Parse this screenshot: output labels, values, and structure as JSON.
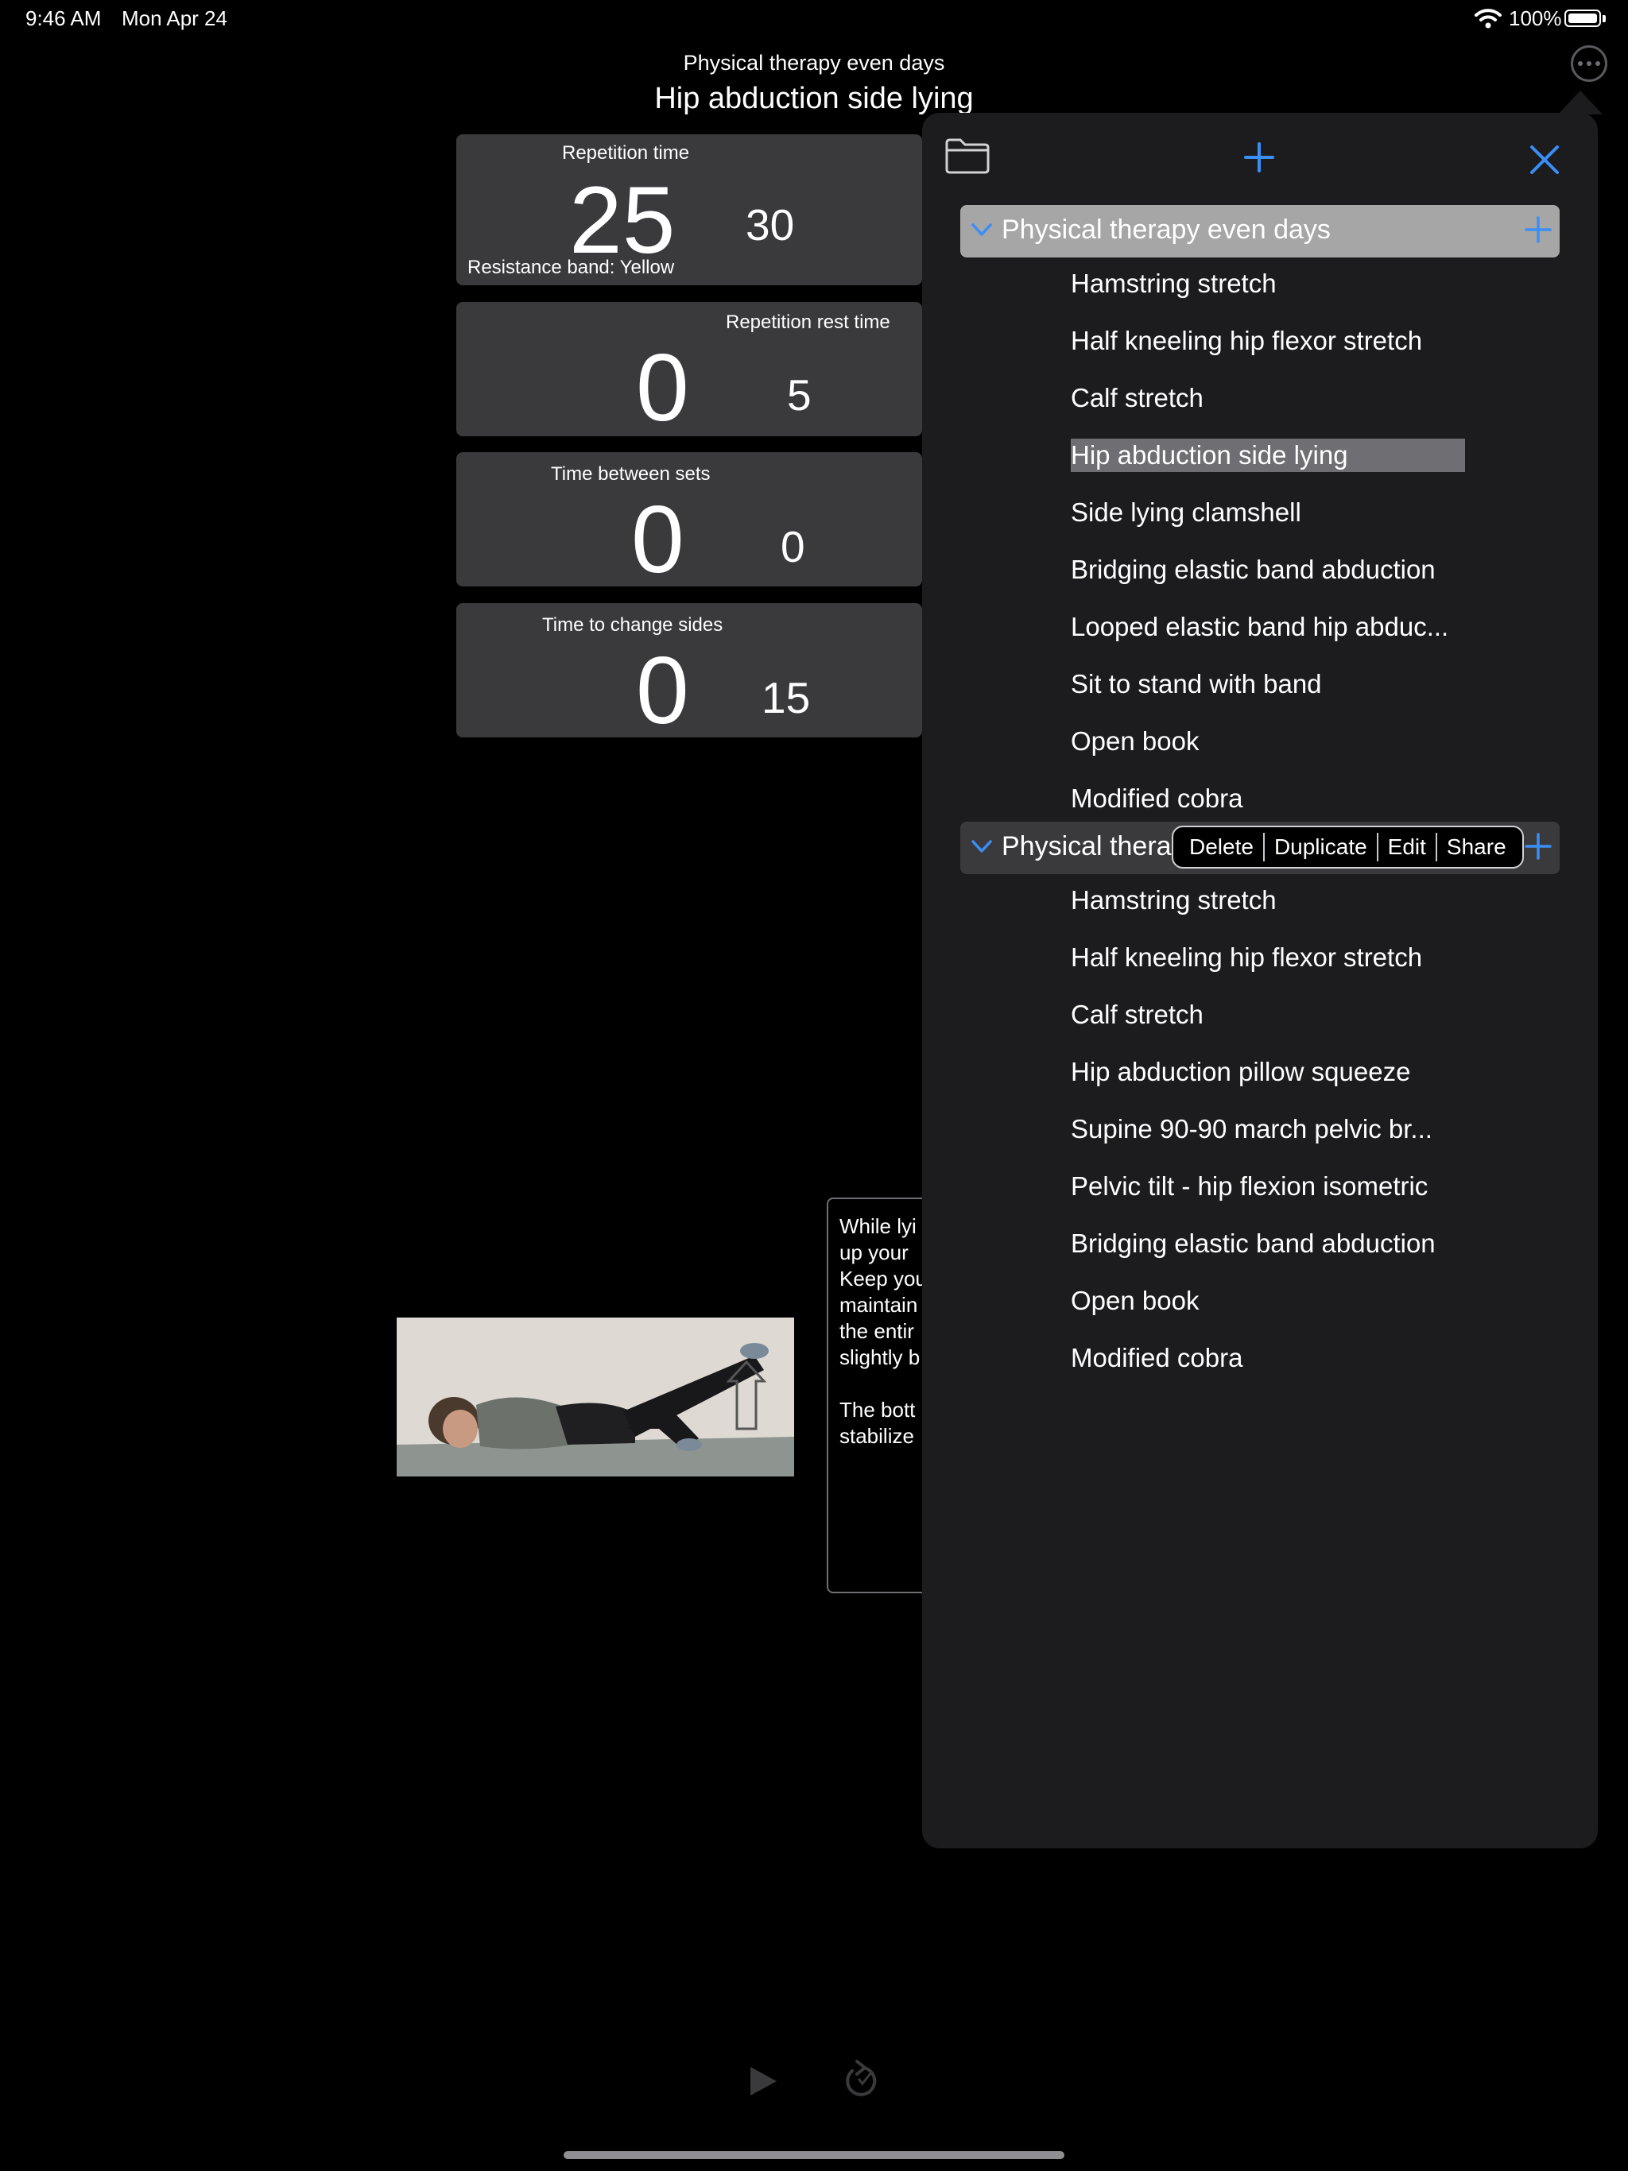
{
  "status_bar": {
    "time": "9:46 AM",
    "date": "Mon Apr 24",
    "battery": "100%",
    "battery_level": 1.0
  },
  "header": {
    "routine": "Physical therapy even days",
    "exercise": "Hip abduction side lying"
  },
  "cards": {
    "repetition": {
      "label": "Repetition time",
      "value": "25",
      "total": "30",
      "note": "Resistance band: Yellow"
    },
    "rep_rest": {
      "label": "Repetition rest time",
      "value": "0",
      "total": "5"
    },
    "between_sets": {
      "label": "Time between sets",
      "value": "0",
      "total": "0"
    },
    "change_sides": {
      "label": "Time to change sides",
      "value": "0",
      "total": "15"
    }
  },
  "description": "While lyi\nup your \nKeep you\nmaintain\nthe entir\nslightly b\n\nThe bott\nstabilize",
  "panel": {
    "groups": [
      {
        "title": "Physical therapy even days",
        "items": [
          "Hamstring stretch",
          "Half kneeling hip flexor stretch",
          "Calf stretch",
          "Hip abduction side lying",
          "Side lying clamshell",
          "Bridging elastic band abduction",
          "Looped elastic band hip abduc...",
          "Sit to stand with band",
          "Open book",
          "Modified cobra"
        ],
        "selected_index": 3
      },
      {
        "title": "Physical thera",
        "items": [
          "Hamstring stretch",
          "Half kneeling hip flexor stretch",
          "Calf stretch",
          "Hip abduction pillow squeeze",
          "Supine 90-90 march pelvic br...",
          "Pelvic tilt - hip flexion isometric",
          "Bridging elastic band abduction",
          "Open book",
          "Modified cobra"
        ]
      }
    ],
    "context_menu": [
      "Delete",
      "Duplicate",
      "Edit",
      "Share"
    ]
  },
  "icons": {
    "accent": "#3a8ef6",
    "names": [
      "wifi-icon",
      "battery-icon",
      "more-icon",
      "folder-icon",
      "add-icon",
      "close-icon",
      "chevron-down-icon",
      "play-icon",
      "reset-icon"
    ]
  }
}
